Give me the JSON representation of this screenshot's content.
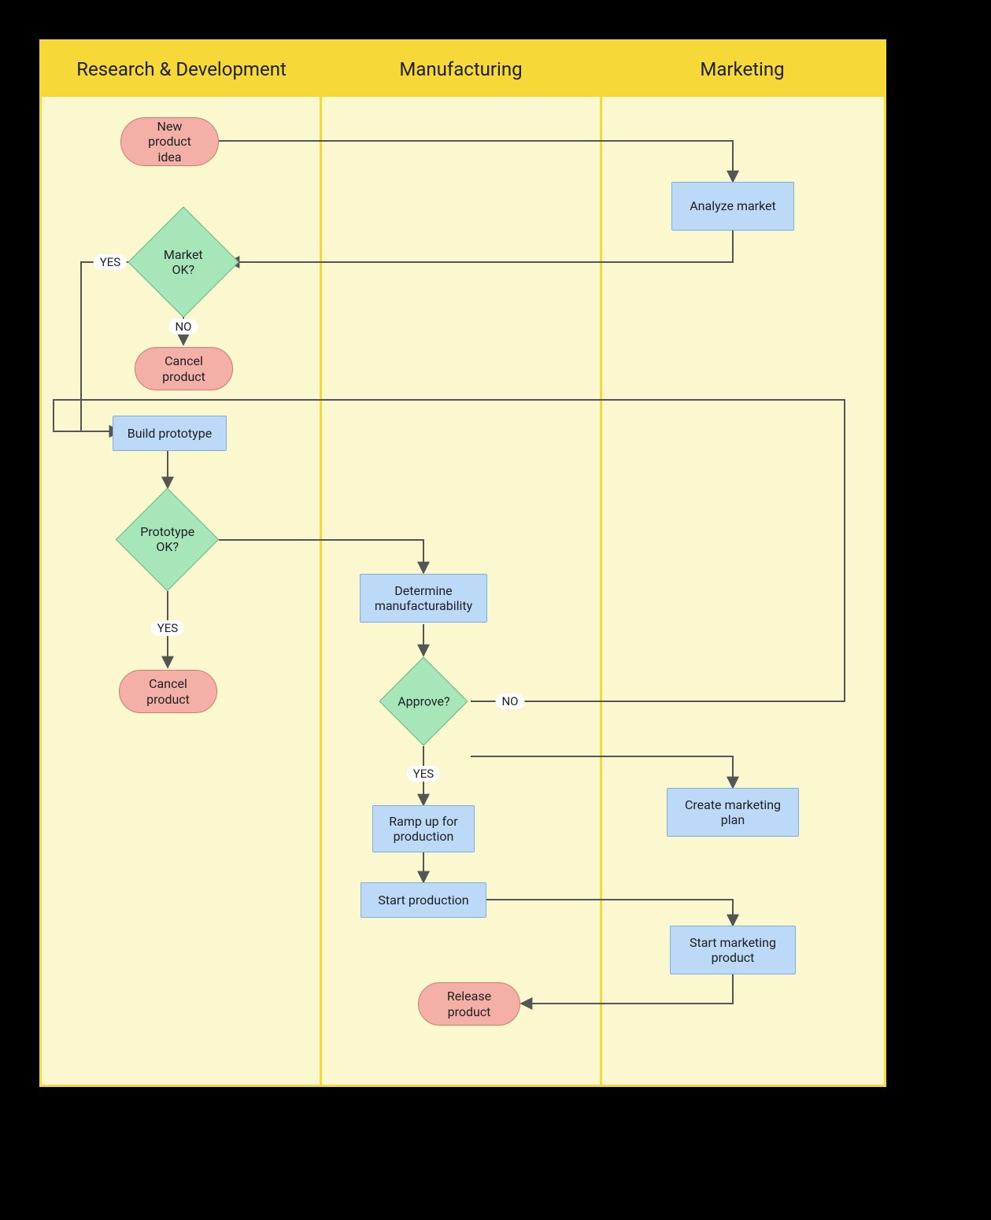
{
  "lanes": [
    {
      "title": "Research & Development"
    },
    {
      "title": "Manufacturing"
    },
    {
      "title": "Marketing"
    }
  ],
  "nodes": {
    "new_idea": {
      "label": "New\nproduct\nidea"
    },
    "analyze_market": {
      "label": "Analyze market"
    },
    "market_ok": {
      "label": "Market\nOK?"
    },
    "cancel1": {
      "label": "Cancel\nproduct"
    },
    "build_proto": {
      "label": "Build prototype"
    },
    "proto_ok": {
      "label": "Prototype\nOK?"
    },
    "cancel2": {
      "label": "Cancel\nproduct"
    },
    "determine": {
      "label": "Determine\nmanufacturability"
    },
    "approve": {
      "label": "Approve?"
    },
    "marketing_plan": {
      "label": "Create marketing\nplan"
    },
    "ramp_up": {
      "label": "Ramp up for\nproduction"
    },
    "start_prod": {
      "label": "Start production"
    },
    "start_mkt": {
      "label": "Start marketing\nproduct"
    },
    "release": {
      "label": "Release\nproduct"
    }
  },
  "edge_labels": {
    "mkt_yes": "YES",
    "mkt_no": "NO",
    "proto_yes": "YES",
    "approve_no": "NO",
    "approve_yes": "YES"
  }
}
